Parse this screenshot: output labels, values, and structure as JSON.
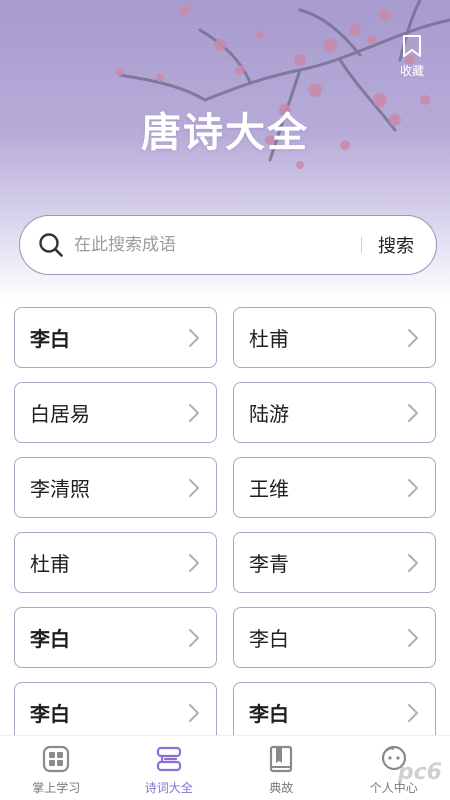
{
  "header": {
    "title": "唐诗大全",
    "favorite_label": "收藏",
    "background_color": "#a79bcf"
  },
  "search": {
    "placeholder": "在此搜索成语",
    "button_label": "搜索"
  },
  "poets": [
    {
      "name": "李白",
      "bold": true
    },
    {
      "name": "杜甫",
      "bold": false
    },
    {
      "name": "白居易",
      "bold": false
    },
    {
      "name": "陆游",
      "bold": false
    },
    {
      "name": "李清照",
      "bold": false
    },
    {
      "name": "王维",
      "bold": false
    },
    {
      "name": "杜甫",
      "bold": false
    },
    {
      "name": "李青",
      "bold": false
    },
    {
      "name": "李白",
      "bold": true
    },
    {
      "name": "李白",
      "bold": false
    },
    {
      "name": "李白",
      "bold": true
    },
    {
      "name": "李白",
      "bold": true
    }
  ],
  "tabs": [
    {
      "label": "掌上学习",
      "icon": "grid-icon",
      "active": false
    },
    {
      "label": "诗词大全",
      "icon": "book-stack-icon",
      "active": true
    },
    {
      "label": "典故",
      "icon": "book-icon",
      "active": false
    },
    {
      "label": "个人中心",
      "icon": "avatar-icon",
      "active": false
    }
  ],
  "colors": {
    "accent": "#8c6fd6",
    "card_border": "#aaa6c4",
    "blossom": "#c98aa8"
  },
  "watermark": "pc6"
}
